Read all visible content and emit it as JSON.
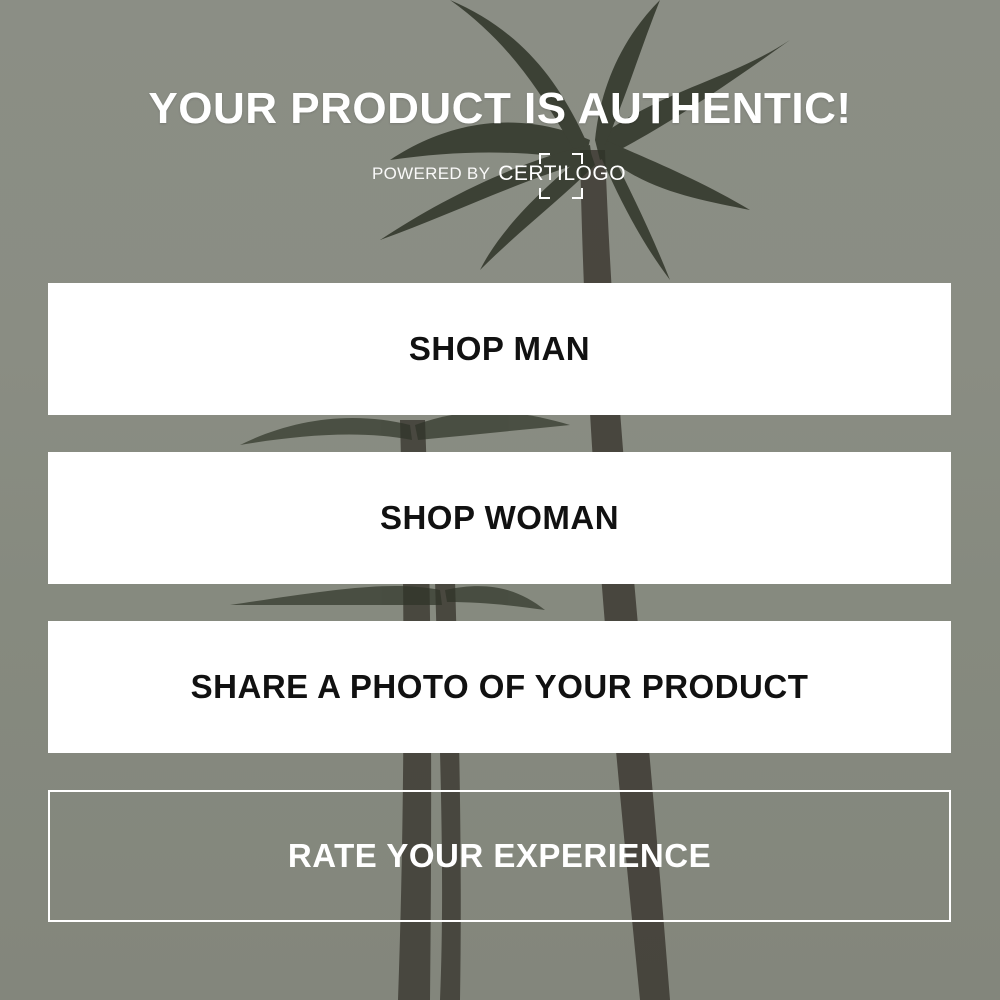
{
  "header": {
    "title": "YOUR PRODUCT IS AUTHENTIC!",
    "powered_by": "POWERED BY",
    "brand": "CERTILOGO"
  },
  "actions": {
    "shop_man": "SHOP MAN",
    "shop_woman": "SHOP WOMAN",
    "share_photo": "SHARE A PHOTO OF YOUR PRODUCT",
    "rate_experience": "RATE YOUR EXPERIENCE"
  },
  "colors": {
    "background": "#878a7f",
    "button_bg": "#ffffff",
    "button_text": "#111111",
    "heading_text": "#ffffff"
  },
  "icons": {
    "background": "palm-trees-photo",
    "logo": "certilogo-frame-icon"
  }
}
